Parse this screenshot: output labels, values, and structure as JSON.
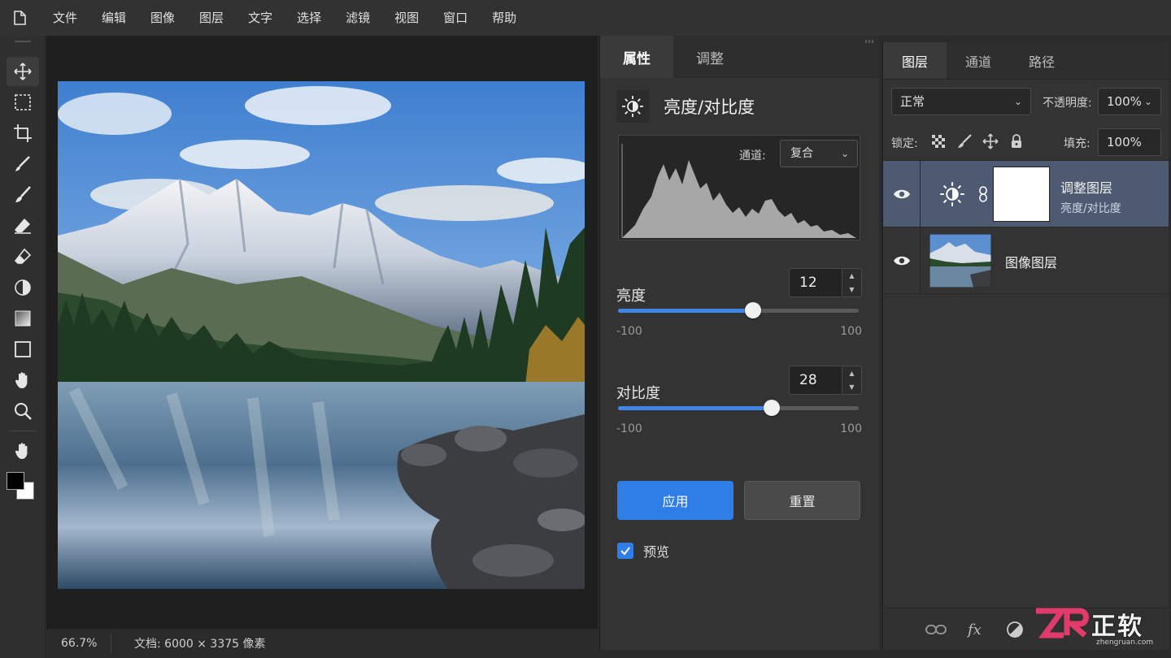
{
  "menu": {
    "items": [
      "文件",
      "编辑",
      "图像",
      "图层",
      "文字",
      "选择",
      "滤镜",
      "视图",
      "窗口",
      "帮助"
    ]
  },
  "toolbar": {
    "tools": [
      "move-icon",
      "marquee-icon",
      "crop-icon",
      "brush-icon",
      "paint-brush-icon",
      "eraser-icon",
      "eraser-alt-icon",
      "dodge-icon",
      "gradient-icon",
      "shape-icon",
      "hand-icon",
      "zoom-icon",
      "hand-grab-icon"
    ]
  },
  "status": {
    "zoom": "66.7%",
    "doc": "文档: 6000 × 3375 像素"
  },
  "properties": {
    "tabs": [
      "属性",
      "调整"
    ],
    "adjustment_title": "亮度/对比度",
    "channel_label": "通道:",
    "channel_value": "复合",
    "brightness": {
      "label": "亮度",
      "value": "12",
      "min": "-100",
      "max": "100",
      "num": 12
    },
    "contrast": {
      "label": "对比度",
      "value": "28",
      "min": "-100",
      "max": "100",
      "num": 28
    },
    "apply_label": "应用",
    "reset_label": "重置",
    "preview_label": "预览"
  },
  "layers_panel": {
    "tabs": [
      "图层",
      "通道",
      "路径"
    ],
    "blend_mode": "正常",
    "opacity_label": "不透明度:",
    "opacity_value": "100%",
    "lock_label": "锁定:",
    "fill_label": "填充:",
    "fill_value": "100%",
    "layers": [
      {
        "name": "调整图层",
        "sub": "亮度/对比度"
      },
      {
        "name": "图像图层"
      }
    ]
  },
  "colors": {
    "accent": "#2f7ee8",
    "selected_layer": "#4d5a71"
  },
  "watermark": {
    "brand": "正软",
    "url": "zhengruan.com"
  }
}
